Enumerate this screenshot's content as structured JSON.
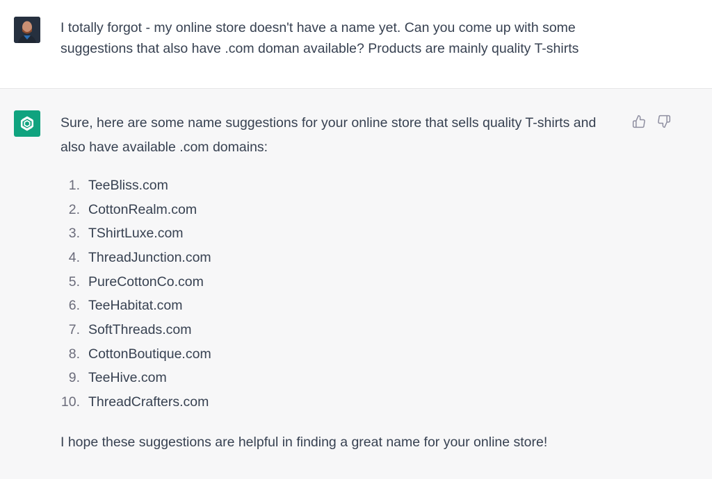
{
  "user": {
    "message": "I totally forgot - my online store doesn't have a name yet. Can you come up with some suggestions that also have .com doman available?   Products are mainly quality T-shirts"
  },
  "assistant": {
    "intro": "Sure, here are some name suggestions for your online store that sells quality T-shirts and also have available .com domains:",
    "items": [
      {
        "num": "1.",
        "text": "TeeBliss.com"
      },
      {
        "num": "2.",
        "text": "CottonRealm.com"
      },
      {
        "num": "3.",
        "text": "TShirtLuxe.com"
      },
      {
        "num": "4.",
        "text": "ThreadJunction.com"
      },
      {
        "num": "5.",
        "text": "PureCottonCo.com"
      },
      {
        "num": "6.",
        "text": "TeeHabitat.com"
      },
      {
        "num": "7.",
        "text": "SoftThreads.com"
      },
      {
        "num": "8.",
        "text": "CottonBoutique.com"
      },
      {
        "num": "9.",
        "text": "TeeHive.com"
      },
      {
        "num": "10.",
        "text": "ThreadCrafters.com"
      }
    ],
    "outro": "I hope these suggestions are helpful in finding a great name for your online store!"
  },
  "icons": {
    "user_avatar": "user-avatar",
    "assistant_logo": "openai-logo-icon",
    "thumbs_up": "thumbs-up-icon",
    "thumbs_down": "thumbs-down-icon"
  },
  "colors": {
    "assistant_bg": "#f7f7f8",
    "logo_bg": "#10a37f",
    "text": "#374151"
  }
}
